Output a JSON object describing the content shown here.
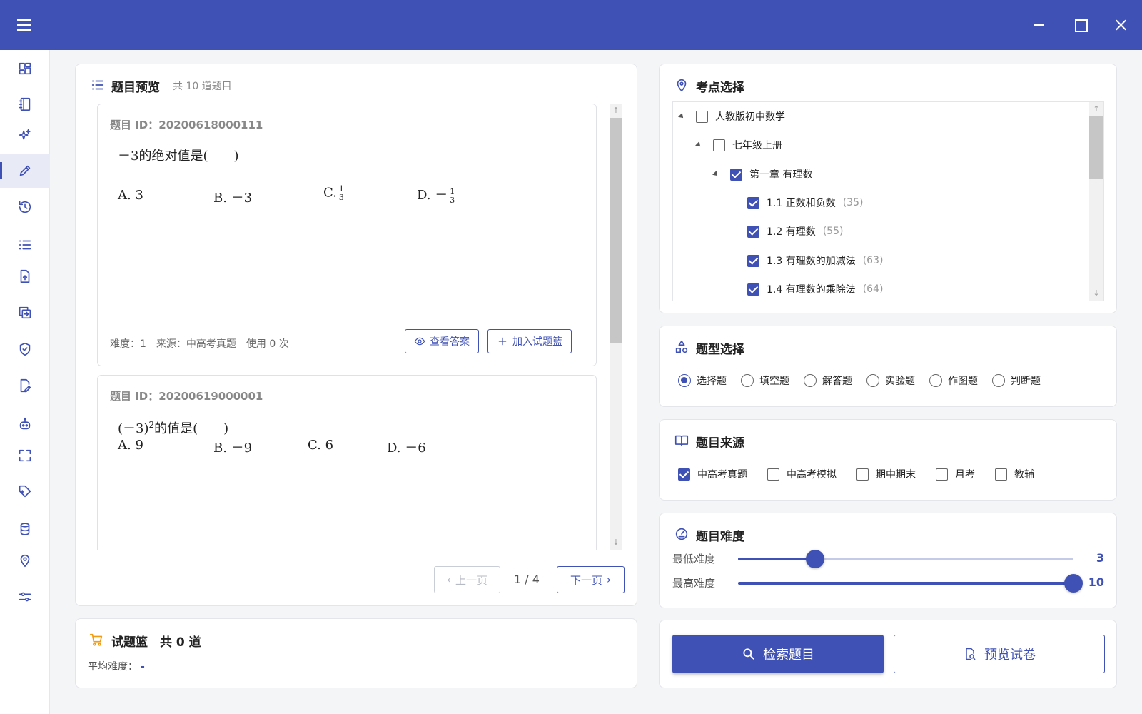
{
  "theme": {
    "primary": "#3f51b5",
    "accent_cart": "#f39c12"
  },
  "titlebar": {
    "menu_icon": "hamburger-icon",
    "minimize_icon": "minimize-icon",
    "maximize_icon": "maximize-icon",
    "close_icon": "close-icon"
  },
  "sidebar": {
    "items": [
      {
        "icon": "dashboard-icon"
      },
      {
        "icon": "notebook-icon"
      },
      {
        "icon": "sparkle-icon"
      },
      {
        "icon": "pencil-icon",
        "active": true
      },
      {
        "icon": "history-icon"
      },
      {
        "icon": "list-icon"
      },
      {
        "icon": "file-upload-icon"
      },
      {
        "icon": "swap-icon"
      },
      {
        "icon": "shield-check-icon"
      },
      {
        "icon": "file-edit-icon"
      },
      {
        "icon": "robot-icon"
      },
      {
        "icon": "fullscreen-icon"
      },
      {
        "icon": "tag-add-icon"
      },
      {
        "icon": "database-icon"
      },
      {
        "icon": "location-icon"
      },
      {
        "icon": "sliders-icon"
      }
    ]
  },
  "preview": {
    "title": "题目预览",
    "count_hint": "共 10 道题目",
    "questions": [
      {
        "id_label": "题目 ID：20200618000111",
        "stem": "－3的绝对值是(　　)",
        "options": [
          {
            "label": "A. 3"
          },
          {
            "label": "B. －3"
          },
          {
            "label": "C.",
            "frac_num": "1",
            "frac_den": "3"
          },
          {
            "label": "D. －",
            "frac_num": "1",
            "frac_den": "3"
          }
        ],
        "meta": "难度：1　来源：中高考真题　使用 0 次",
        "view_answer": "查看答案",
        "add_basket": "加入试题篮"
      },
      {
        "id_label": "题目 ID：20200619000001",
        "stem_base": "(－3)",
        "stem_sup": "2",
        "stem_rest": "的值是(　　)",
        "options": [
          {
            "label": "A. 9"
          },
          {
            "label": "B. －9"
          },
          {
            "label": "C. 6"
          },
          {
            "label": "D. －6"
          }
        ]
      }
    ],
    "pager": {
      "prev": "上一页",
      "next": "下一页",
      "info": "1 / 4"
    }
  },
  "basket": {
    "title": "试题篮",
    "count": "共 0 道",
    "avg_label": "平均难度：",
    "avg_value": "-"
  },
  "knowledge": {
    "title": "考点选择",
    "tree": [
      {
        "label": "人教版初中数学",
        "count": "",
        "checked": false,
        "level": 0,
        "toggle": true
      },
      {
        "label": "七年级上册",
        "count": "",
        "checked": false,
        "level": 1,
        "toggle": true
      },
      {
        "label": "第一章 有理数",
        "count": "",
        "checked": true,
        "level": 2,
        "toggle": true
      },
      {
        "label": "1.1 正数和负数",
        "count": "(35)",
        "checked": true,
        "level": 3,
        "toggle": false
      },
      {
        "label": "1.2 有理数",
        "count": "(55)",
        "checked": true,
        "level": 3,
        "toggle": false
      },
      {
        "label": "1.3 有理数的加减法",
        "count": "(63)",
        "checked": true,
        "level": 3,
        "toggle": false
      },
      {
        "label": "1.4 有理数的乘除法",
        "count": "(64)",
        "checked": true,
        "level": 3,
        "toggle": false
      }
    ]
  },
  "qtype": {
    "title": "题型选择",
    "options": [
      {
        "label": "选择题",
        "selected": true
      },
      {
        "label": "填空题",
        "selected": false
      },
      {
        "label": "解答题",
        "selected": false
      },
      {
        "label": "实验题",
        "selected": false
      },
      {
        "label": "作图题",
        "selected": false
      },
      {
        "label": "判断题",
        "selected": false
      }
    ]
  },
  "source": {
    "title": "题目来源",
    "options": [
      {
        "label": "中高考真题",
        "checked": true
      },
      {
        "label": "中高考模拟",
        "checked": false
      },
      {
        "label": "期中期末",
        "checked": false
      },
      {
        "label": "月考",
        "checked": false
      },
      {
        "label": "教辅",
        "checked": false
      }
    ]
  },
  "difficulty": {
    "title": "题目难度",
    "min_label": "最低难度",
    "min_value": "3",
    "min_fraction": 0.23,
    "max_label": "最高难度",
    "max_value": "10",
    "max_fraction": 1.0
  },
  "actions": {
    "search": "检索题目",
    "preview_paper": "预览试卷"
  }
}
